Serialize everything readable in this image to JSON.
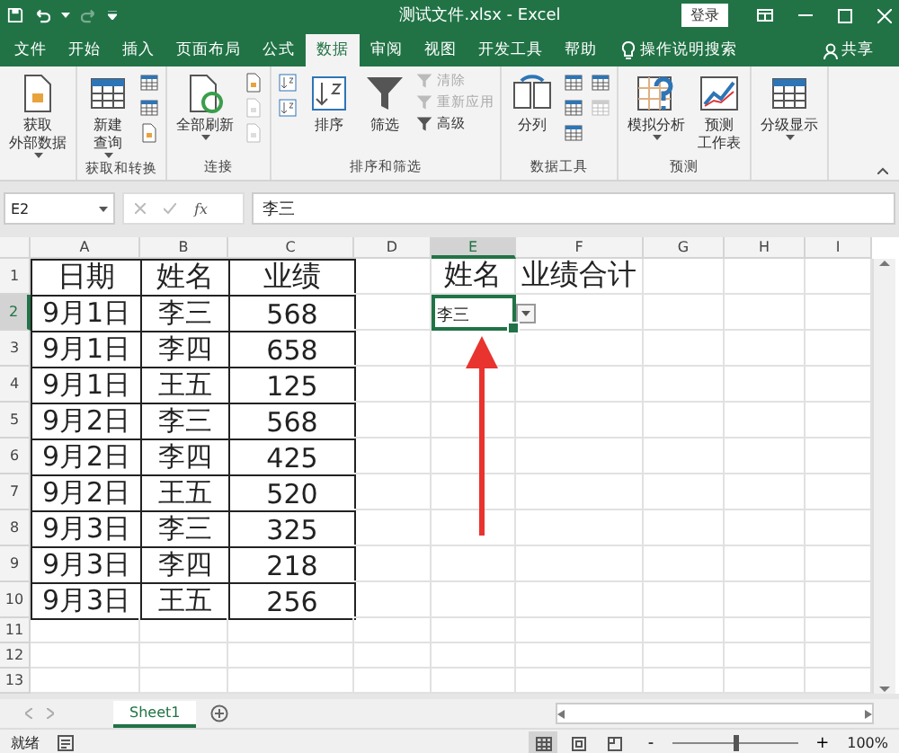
{
  "window": {
    "title": "测试文件.xlsx  -  Excel",
    "sign_in": "登录",
    "redo_disabled": true
  },
  "tabs": [
    {
      "label": "文件",
      "selected": false
    },
    {
      "label": "开始",
      "selected": false
    },
    {
      "label": "插入",
      "selected": false
    },
    {
      "label": "页面布局",
      "selected": false
    },
    {
      "label": "公式",
      "selected": false
    },
    {
      "label": "数据",
      "selected": true
    },
    {
      "label": "审阅",
      "selected": false
    },
    {
      "label": "视图",
      "selected": false
    },
    {
      "label": "开发工具",
      "selected": false
    },
    {
      "label": "帮助",
      "selected": false
    }
  ],
  "tell_me": {
    "placeholder": "操作说明搜索"
  },
  "share": "共享",
  "ribbon": {
    "groups": [
      {
        "buttons": [
          {
            "kind": "large",
            "lines": [
              "获取",
              "外部数据"
            ],
            "menu": true
          }
        ]
      },
      {
        "label": "获取和转换",
        "buttons": [
          {
            "kind": "large",
            "lines": [
              "新建",
              "查询"
            ],
            "menu": true
          },
          {
            "kind": "stack",
            "items": [
              {
                "kind": "icon",
                "disabled": false
              },
              {
                "kind": "icon",
                "disabled": false
              },
              {
                "kind": "icon",
                "disabled": false
              }
            ]
          }
        ]
      },
      {
        "label": "连接",
        "buttons": [
          {
            "kind": "large",
            "lines": [
              "全部刷新"
            ],
            "menu": true
          },
          {
            "kind": "stack",
            "items": [
              {
                "kind": "icon",
                "disabled": false
              },
              {
                "kind": "icon",
                "disabled": true
              },
              {
                "kind": "icon",
                "disabled": true
              }
            ]
          }
        ]
      },
      {
        "label": "排序和筛选",
        "buttons": [
          {
            "kind": "stack",
            "items": [
              {
                "kind": "icon",
                "disabled": false
              },
              {
                "kind": "icon",
                "disabled": false
              }
            ]
          },
          {
            "kind": "large",
            "lines": [
              "排序"
            ],
            "menu": false
          },
          {
            "kind": "large",
            "lines": [
              "筛选"
            ],
            "menu": false
          },
          {
            "kind": "stack",
            "items": [
              {
                "kind": "text",
                "label": "清除",
                "disabled": true
              },
              {
                "kind": "text",
                "label": "重新应用",
                "disabled": true
              },
              {
                "kind": "text",
                "label": "高级",
                "disabled": false
              }
            ]
          }
        ]
      },
      {
        "label": "数据工具",
        "buttons": [
          {
            "kind": "large",
            "lines": [
              "分列"
            ],
            "menu": false
          },
          {
            "kind": "stack",
            "items": [
              {
                "kind": "icon",
                "disabled": false
              },
              {
                "kind": "icon",
                "disabled": false
              },
              {
                "kind": "icon",
                "disabled": false
              }
            ]
          },
          {
            "kind": "stack",
            "items": [
              {
                "kind": "icon",
                "disabled": false
              },
              {
                "kind": "icon",
                "disabled": true
              }
            ]
          }
        ]
      },
      {
        "label": "预测",
        "buttons": [
          {
            "kind": "large",
            "lines": [
              "模拟分析"
            ],
            "menu": true
          },
          {
            "kind": "large",
            "lines": [
              "预测",
              "工作表"
            ],
            "menu": false
          }
        ]
      },
      {
        "buttons": [
          {
            "kind": "large",
            "lines": [
              "分级显示"
            ],
            "menu": true
          }
        ]
      }
    ]
  },
  "formula_bar": {
    "name_box": "E2",
    "function_label": "fx",
    "value": "李三"
  },
  "grid": {
    "columns": [
      {
        "label": "A",
        "selected": false
      },
      {
        "label": "B",
        "selected": false
      },
      {
        "label": "C",
        "selected": false
      },
      {
        "label": "D",
        "selected": false
      },
      {
        "label": "E",
        "selected": true
      },
      {
        "label": "F",
        "selected": false
      },
      {
        "label": "G",
        "selected": false
      },
      {
        "label": "H",
        "selected": false
      },
      {
        "label": "I",
        "selected": false
      }
    ],
    "rows": [
      {
        "number": "1",
        "selected": false,
        "cells": [
          "日期",
          "姓名",
          "业绩",
          null,
          "姓名",
          "业绩合计"
        ]
      },
      {
        "number": "2",
        "selected": true,
        "cells": [
          "9月1日",
          "李三",
          "568",
          null,
          {
            "text": "李三",
            "kind": "dropdown"
          }
        ]
      },
      {
        "number": "3",
        "selected": false,
        "cells": [
          "9月1日",
          "李四",
          "658"
        ]
      },
      {
        "number": "4",
        "selected": false,
        "cells": [
          "9月1日",
          "王五",
          "125"
        ]
      },
      {
        "number": "5",
        "selected": false,
        "cells": [
          "9月2日",
          "李三",
          "568"
        ]
      },
      {
        "number": "6",
        "selected": false,
        "cells": [
          "9月2日",
          "李四",
          "425"
        ]
      },
      {
        "number": "7",
        "selected": false,
        "cells": [
          "9月2日",
          "王五",
          "520"
        ]
      },
      {
        "number": "8",
        "selected": false,
        "cells": [
          "9月3日",
          "李三",
          "325"
        ]
      },
      {
        "number": "9",
        "selected": false,
        "cells": [
          "9月3日",
          "李四",
          "218"
        ]
      },
      {
        "number": "10",
        "selected": false,
        "cells": [
          "9月3日",
          "王五",
          "256"
        ]
      },
      {
        "number": "11",
        "selected": false,
        "cells": []
      },
      {
        "number": "12",
        "selected": false,
        "cells": []
      },
      {
        "number": "13",
        "selected": false,
        "cells": []
      }
    ]
  },
  "sheets": [
    {
      "label": "Sheet1",
      "selected": true
    }
  ],
  "status_bar": {
    "status": "就绪",
    "views": [
      {
        "selected": true
      },
      {
        "selected": false
      },
      {
        "selected": false
      }
    ],
    "zoom_out": "-",
    "zoom_in": "+",
    "zoom": {
      "level": 0.5
    },
    "zoom_label": "100%"
  }
}
